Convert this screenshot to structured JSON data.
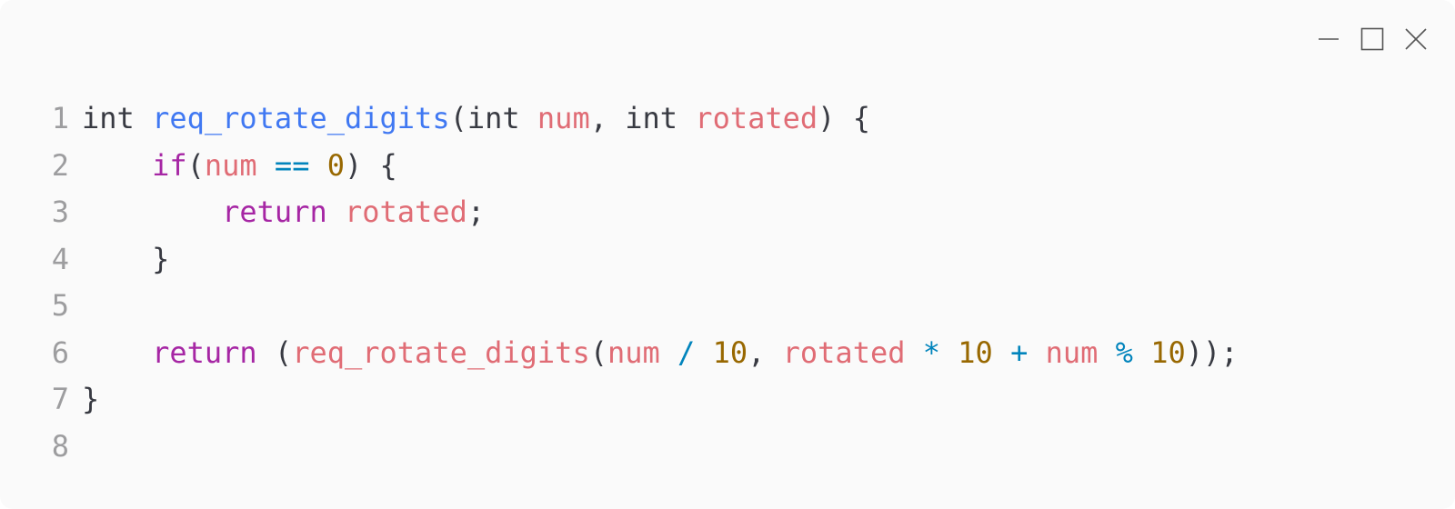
{
  "colors": {
    "background": "#fafafa",
    "default": "#383a42",
    "type": "#383a42",
    "function": "#4078f2",
    "variable": "#e06c75",
    "keyword": "#a626a4",
    "operator": "#0184bc",
    "number": "#986801",
    "punct": "#383a42",
    "line_number": "#9d9d9f"
  },
  "window_controls": [
    "minimize-icon",
    "maximize-icon",
    "close-icon"
  ],
  "code_lines": [
    {
      "number": "1",
      "tokens": [
        {
          "t": "int",
          "c": "type"
        },
        {
          "t": " ",
          "c": "default"
        },
        {
          "t": "req_rotate_digits",
          "c": "function"
        },
        {
          "t": "(",
          "c": "punct"
        },
        {
          "t": "int",
          "c": "type"
        },
        {
          "t": " ",
          "c": "default"
        },
        {
          "t": "num",
          "c": "variable"
        },
        {
          "t": ", ",
          "c": "punct"
        },
        {
          "t": "int",
          "c": "type"
        },
        {
          "t": " ",
          "c": "default"
        },
        {
          "t": "rotated",
          "c": "variable"
        },
        {
          "t": ") {",
          "c": "punct"
        }
      ]
    },
    {
      "number": "2",
      "tokens": [
        {
          "t": "    ",
          "c": "default"
        },
        {
          "t": "if",
          "c": "keyword"
        },
        {
          "t": "(",
          "c": "punct"
        },
        {
          "t": "num",
          "c": "variable"
        },
        {
          "t": " ",
          "c": "default"
        },
        {
          "t": "==",
          "c": "operator"
        },
        {
          "t": " ",
          "c": "default"
        },
        {
          "t": "0",
          "c": "number"
        },
        {
          "t": ") {",
          "c": "punct"
        }
      ]
    },
    {
      "number": "3",
      "tokens": [
        {
          "t": "        ",
          "c": "default"
        },
        {
          "t": "return",
          "c": "keyword"
        },
        {
          "t": " ",
          "c": "default"
        },
        {
          "t": "rotated",
          "c": "variable"
        },
        {
          "t": ";",
          "c": "punct"
        }
      ]
    },
    {
      "number": "4",
      "tokens": [
        {
          "t": "    ",
          "c": "default"
        },
        {
          "t": "}",
          "c": "punct"
        }
      ]
    },
    {
      "number": "5",
      "tokens": []
    },
    {
      "number": "6",
      "tokens": [
        {
          "t": "    ",
          "c": "default"
        },
        {
          "t": "return",
          "c": "keyword"
        },
        {
          "t": " ",
          "c": "default"
        },
        {
          "t": "(",
          "c": "punct"
        },
        {
          "t": "req_rotate_digits",
          "c": "variable"
        },
        {
          "t": "(",
          "c": "punct"
        },
        {
          "t": "num",
          "c": "variable"
        },
        {
          "t": " ",
          "c": "default"
        },
        {
          "t": "/",
          "c": "operator"
        },
        {
          "t": " ",
          "c": "default"
        },
        {
          "t": "10",
          "c": "number"
        },
        {
          "t": ", ",
          "c": "punct"
        },
        {
          "t": "rotated",
          "c": "variable"
        },
        {
          "t": " ",
          "c": "default"
        },
        {
          "t": "*",
          "c": "operator"
        },
        {
          "t": " ",
          "c": "default"
        },
        {
          "t": "10",
          "c": "number"
        },
        {
          "t": " ",
          "c": "default"
        },
        {
          "t": "+",
          "c": "operator"
        },
        {
          "t": " ",
          "c": "default"
        },
        {
          "t": "num",
          "c": "variable"
        },
        {
          "t": " ",
          "c": "default"
        },
        {
          "t": "%",
          "c": "operator"
        },
        {
          "t": " ",
          "c": "default"
        },
        {
          "t": "10",
          "c": "number"
        },
        {
          "t": "));",
          "c": "punct"
        }
      ]
    },
    {
      "number": "7",
      "tokens": [
        {
          "t": "}",
          "c": "punct"
        }
      ]
    },
    {
      "number": "8",
      "tokens": []
    }
  ]
}
